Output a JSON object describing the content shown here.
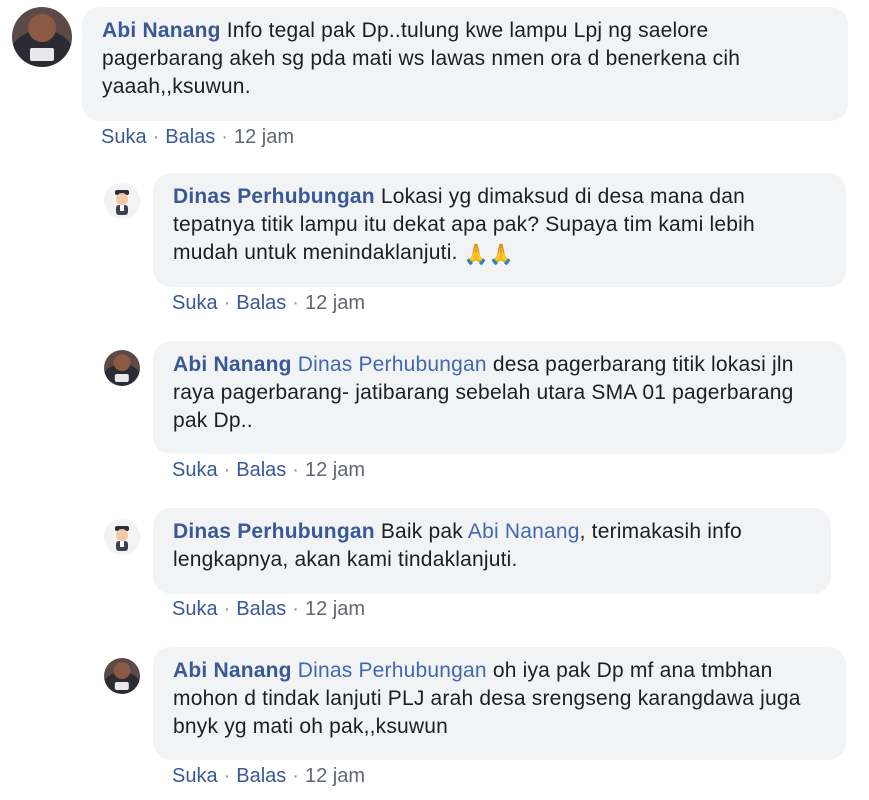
{
  "comments": [
    {
      "author": "Abi Nanang",
      "mention": "",
      "text": "Info tegal pak Dp..tulung kwe lampu Lpj ng saelore pagerbarang akeh sg pda mati ws lawas nmen ora d benerkena cih yaaah,,ksuwun.",
      "like_label": "Suka",
      "reply_label": "Balas",
      "time": "12 jam"
    },
    {
      "author": "Dinas Perhubungan",
      "mention": "",
      "text": "Lokasi yg dimaksud di desa mana dan tepatnya titik lampu itu dekat apa pak? Supaya tim kami lebih mudah untuk menindaklanjuti.",
      "emoji": "🙏🙏",
      "like_label": "Suka",
      "reply_label": "Balas",
      "time": "12 jam"
    },
    {
      "author": "Abi Nanang",
      "mention": "Dinas Perhubungan",
      "text": "desa pagerbarang titik lokasi jln raya pagerbarang- jatibarang sebelah utara SMA 01 pagerbarang pak Dp..",
      "like_label": "Suka",
      "reply_label": "Balas",
      "time": "12 jam"
    },
    {
      "author": "Dinas Perhubungan",
      "text_before": "Baik pak",
      "mention": "Abi Nanang",
      "text": ", terimakasih info lengkapnya, akan kami tindaklanjuti.",
      "like_label": "Suka",
      "reply_label": "Balas",
      "time": "12 jam"
    },
    {
      "author": "Abi Nanang",
      "mention": "Dinas Perhubungan",
      "text": "oh iya pak Dp mf ana tmbhan mohon d tindak lanjuti PLJ arah desa srengseng karangdawa juga bnyk yg mati oh pak,,ksuwun",
      "like_label": "Suka",
      "reply_label": "Balas",
      "time": "12 jam"
    }
  ],
  "colors": {
    "author": "#385898",
    "mention": "#4267b2",
    "bubble": "#f2f3f5",
    "meta": "#606770"
  },
  "icons": {
    "abi_avatar": "profile-photo",
    "dinas_avatar": "police-cartoon-icon"
  }
}
